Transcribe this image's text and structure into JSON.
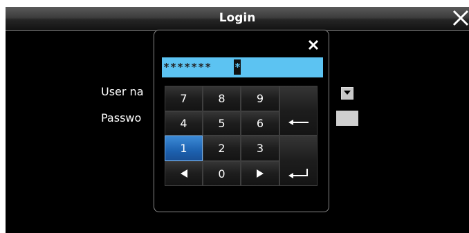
{
  "window": {
    "title": "Login"
  },
  "form": {
    "user_label": "User na",
    "password_label": "Passwo"
  },
  "keypad": {
    "display_value": "*******",
    "cursor_char": "*",
    "keys": {
      "k7": "7",
      "k8": "8",
      "k9": "9",
      "k4": "4",
      "k5": "5",
      "k6": "6",
      "k1": "1",
      "k2": "2",
      "k3": "3",
      "k0": "0"
    },
    "selected_key": "1"
  },
  "colors": {
    "display_bg": "#5cc3f2",
    "selected_key": "#1d62b0",
    "window_bg": "#000000"
  }
}
